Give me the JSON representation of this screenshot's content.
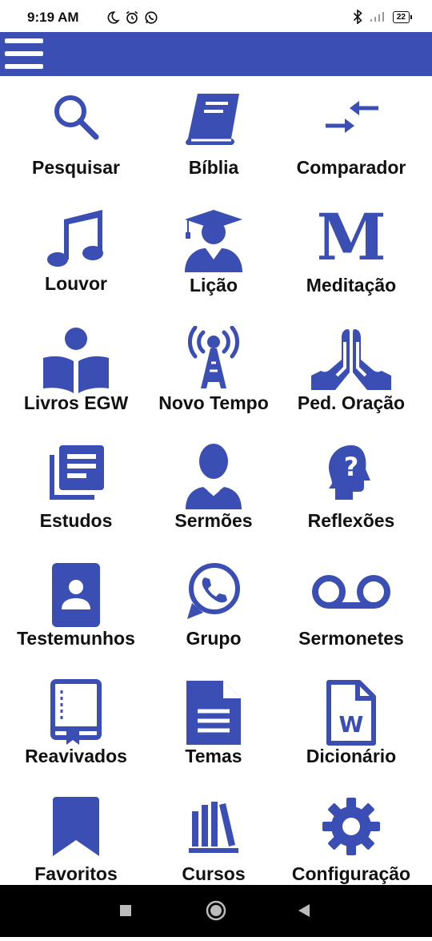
{
  "status_bar": {
    "time": "9:19 AM",
    "battery": "22"
  },
  "theme": {
    "accent": "#3b4eb4"
  },
  "menu": [
    {
      "label": "Pesquisar",
      "icon": "search-icon"
    },
    {
      "label": "Bíblia",
      "icon": "bible-icon"
    },
    {
      "label": "Comparador",
      "icon": "compare-arrows-icon"
    },
    {
      "label": "Louvor",
      "icon": "music-note-icon"
    },
    {
      "label": "Lição",
      "icon": "graduate-icon"
    },
    {
      "label": "Meditação",
      "icon": "meditation-m-icon"
    },
    {
      "label": "Livros EGW",
      "icon": "reader-book-icon"
    },
    {
      "label": "Novo Tempo",
      "icon": "radio-tower-icon"
    },
    {
      "label": "Ped. Oração",
      "icon": "praying-hands-icon"
    },
    {
      "label": "Estudos",
      "icon": "library-books-icon"
    },
    {
      "label": "Sermões",
      "icon": "preacher-icon"
    },
    {
      "label": "Reflexões",
      "icon": "head-question-icon"
    },
    {
      "label": "Testemunhos",
      "icon": "contact-card-icon"
    },
    {
      "label": "Grupo",
      "icon": "whatsapp-icon"
    },
    {
      "label": "Sermonetes",
      "icon": "voicemail-icon"
    },
    {
      "label": "Reavivados",
      "icon": "notebook-bookmark-icon"
    },
    {
      "label": "Temas",
      "icon": "document-icon"
    },
    {
      "label": "Dicionário",
      "icon": "word-file-icon"
    },
    {
      "label": "Favoritos",
      "icon": "bookmark-icon"
    },
    {
      "label": "Cursos",
      "icon": "books-shelf-icon"
    },
    {
      "label": "Configuração",
      "icon": "gear-icon"
    }
  ]
}
